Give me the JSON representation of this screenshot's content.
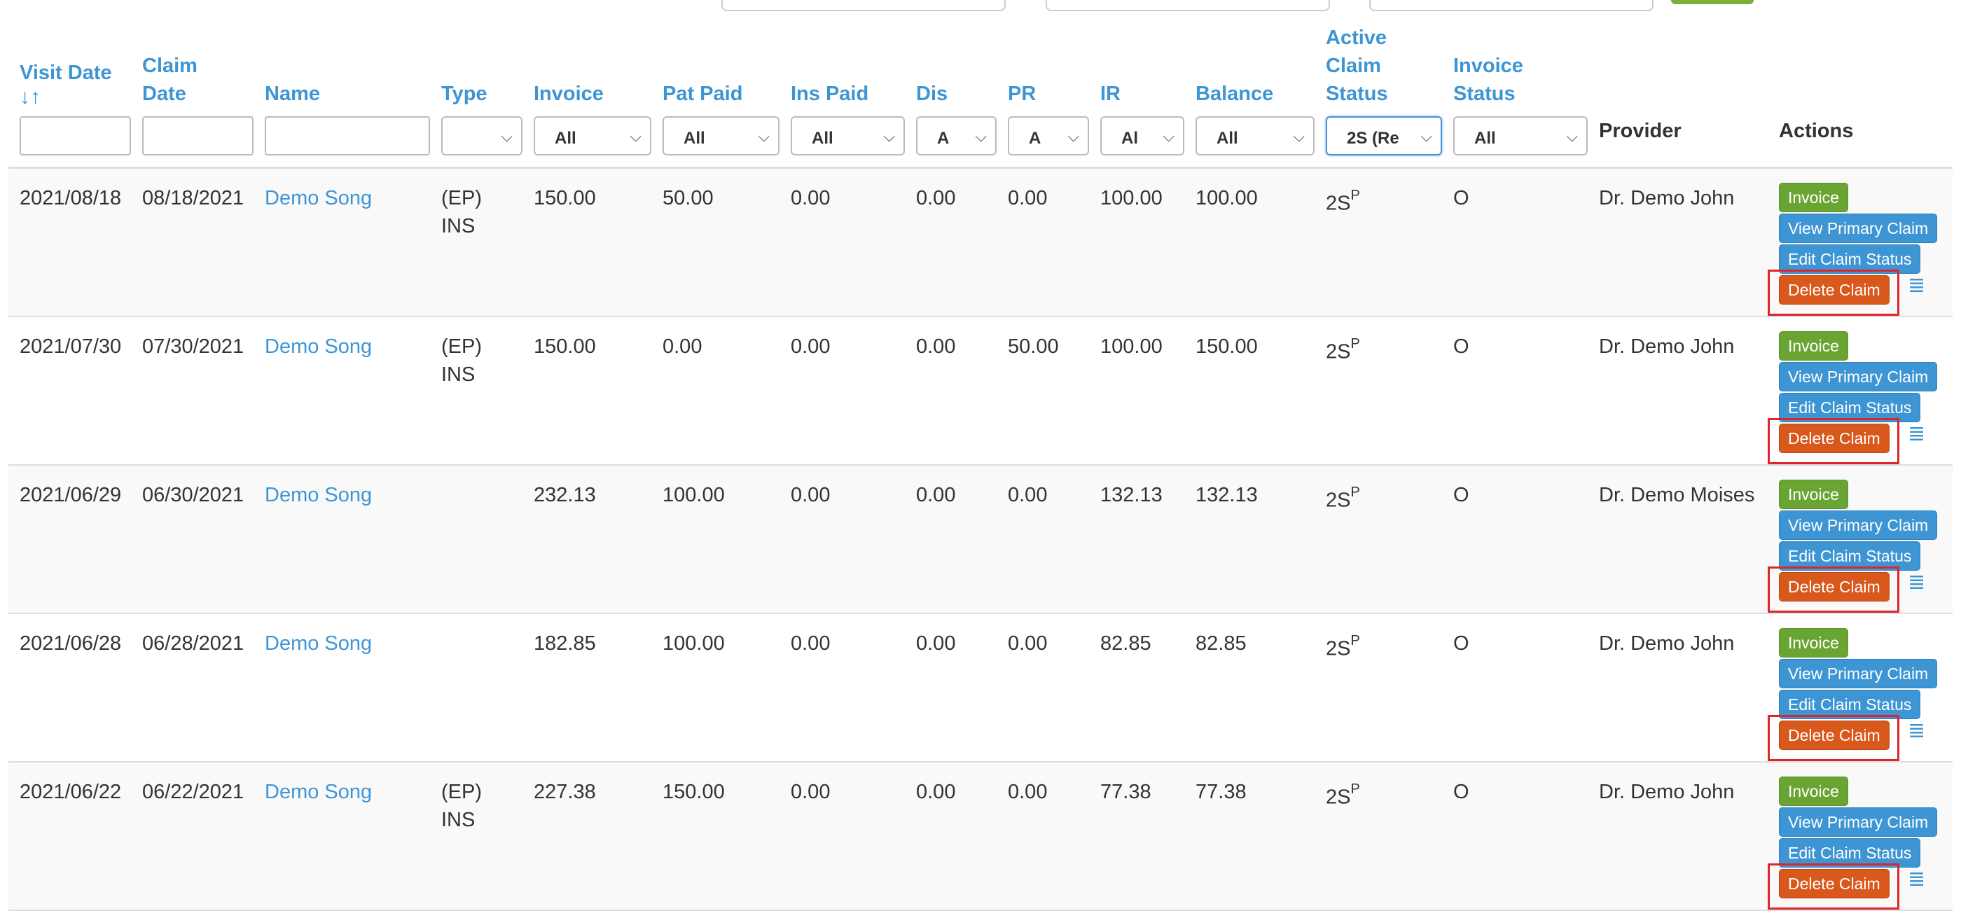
{
  "columns": {
    "visit_date": "Visit Date",
    "sort_icon": "↓↑",
    "claim_date_1": "Claim",
    "claim_date_2": "Date",
    "name": "Name",
    "type": "Type",
    "invoice": "Invoice",
    "pat_paid": "Pat Paid",
    "ins_paid": "Ins Paid",
    "dis": "Dis",
    "pr": "PR",
    "ir": "IR",
    "balance": "Balance",
    "active_1": "Active",
    "active_2": "Claim",
    "active_3": "Status",
    "inv_status_1": "Invoice",
    "inv_status_2": "Status",
    "provider": "Provider",
    "actions": "Actions"
  },
  "filters": {
    "type": "",
    "invoice": "All",
    "pat_paid": "All",
    "ins_paid": "All",
    "dis": "A",
    "pr": "A",
    "ir": "Al",
    "balance": "All",
    "active_claim_status": "2S (Re",
    "invoice_status": "All",
    "chevron": "⌵"
  },
  "action_labels": {
    "invoice": "Invoice",
    "view_primary": "View Primary Claim",
    "edit_status": "Edit Claim Status",
    "delete": "Delete Claim",
    "menu": "≣"
  },
  "rows": [
    {
      "visit_date": "2021/08/18",
      "claim_date": "08/18/2021",
      "name": "Demo Song",
      "type_1": "(EP)",
      "type_2": "INS",
      "invoice": "150.00",
      "pat_paid": "50.00",
      "ins_paid": "0.00",
      "dis": "0.00",
      "pr": "0.00",
      "ir": "100.00",
      "balance": "100.00",
      "status": "2S",
      "status_sup": "P",
      "invoice_status": "O",
      "provider": "Dr. Demo John"
    },
    {
      "visit_date": "2021/07/30",
      "claim_date": "07/30/2021",
      "name": "Demo Song",
      "type_1": "(EP)",
      "type_2": "INS",
      "invoice": "150.00",
      "pat_paid": "0.00",
      "ins_paid": "0.00",
      "dis": "0.00",
      "pr": "50.00",
      "ir": "100.00",
      "balance": "150.00",
      "status": "2S",
      "status_sup": "P",
      "invoice_status": "O",
      "provider": "Dr. Demo John"
    },
    {
      "visit_date": "2021/06/29",
      "claim_date": "06/30/2021",
      "name": "Demo Song",
      "type_1": "",
      "type_2": "",
      "invoice": "232.13",
      "pat_paid": "100.00",
      "ins_paid": "0.00",
      "dis": "0.00",
      "pr": "0.00",
      "ir": "132.13",
      "balance": "132.13",
      "status": "2S",
      "status_sup": "P",
      "invoice_status": "O",
      "provider": "Dr. Demo Moises"
    },
    {
      "visit_date": "2021/06/28",
      "claim_date": "06/28/2021",
      "name": "Demo Song",
      "type_1": "",
      "type_2": "",
      "invoice": "182.85",
      "pat_paid": "100.00",
      "ins_paid": "0.00",
      "dis": "0.00",
      "pr": "0.00",
      "ir": "82.85",
      "balance": "82.85",
      "status": "2S",
      "status_sup": "P",
      "invoice_status": "O",
      "provider": "Dr. Demo John"
    },
    {
      "visit_date": "2021/06/22",
      "claim_date": "06/22/2021",
      "name": "Demo Song",
      "type_1": "(EP)",
      "type_2": "INS",
      "invoice": "227.38",
      "pat_paid": "150.00",
      "ins_paid": "0.00",
      "dis": "0.00",
      "pr": "0.00",
      "ir": "77.38",
      "balance": "77.38",
      "status": "2S",
      "status_sup": "P",
      "invoice_status": "O",
      "provider": "Dr. Demo John"
    }
  ]
}
